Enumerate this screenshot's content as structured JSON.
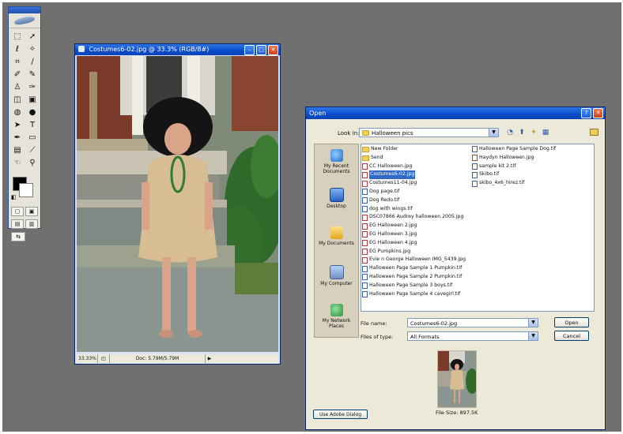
{
  "image_window": {
    "title": "Costumes6-02.jpg @ 33.3% (RGB/8#)",
    "status_zoom": "33.33%",
    "status_doc": "Doc: 5.79M/5.79M"
  },
  "dialog": {
    "title": "Open",
    "look_in_label": "Look in:",
    "look_in_value": "Halloween pics",
    "places": [
      {
        "label": "My Recent Documents",
        "icon": "recent-documents-icon"
      },
      {
        "label": "Desktop",
        "icon": "desktop-icon"
      },
      {
        "label": "My Documents",
        "icon": "my-documents-icon"
      },
      {
        "label": "My Computer",
        "icon": "my-computer-icon"
      },
      {
        "label": "My Network Places",
        "icon": "network-places-icon"
      }
    ],
    "files_col1": [
      {
        "name": "New Folder",
        "type": "folder"
      },
      {
        "name": "Send",
        "type": "folder"
      },
      {
        "name": "CC Halloween.jpg",
        "type": "jpg"
      },
      {
        "name": "Costumes6-02.jpg",
        "type": "jpg",
        "selected": true
      },
      {
        "name": "Costumes11-04.jpg",
        "type": "jpg"
      },
      {
        "name": "Dog page.tif",
        "type": "tif"
      },
      {
        "name": "Dog Redo.tif",
        "type": "tif"
      },
      {
        "name": "dog with wings.tif",
        "type": "tif"
      },
      {
        "name": "DSC07866 Audrey halloween 2005.jpg",
        "type": "jpg"
      },
      {
        "name": "EG Halloween 2.jpg",
        "type": "jpg"
      },
      {
        "name": "EG Halloween 3.jpg",
        "type": "jpg"
      },
      {
        "name": "EG Halloween 4.jpg",
        "type": "jpg"
      },
      {
        "name": "EG Pumpkins.jpg",
        "type": "jpg"
      },
      {
        "name": "Evie n George Halloween IMG_5439.jpg",
        "type": "jpg"
      },
      {
        "name": "Halloween Page Sample 1 Pumpkin.tif",
        "type": "tif"
      },
      {
        "name": "Halloween Page Sample 2 Pumpkin.tif",
        "type": "tif"
      },
      {
        "name": "Halloween Page Sample 3 boys.tif",
        "type": "tif"
      },
      {
        "name": "Halloween Page Sample 4 cavegirl.tif",
        "type": "tif"
      }
    ],
    "files_col2": [
      {
        "name": "Halloween Page Sample Dog.tif",
        "type": "tif"
      },
      {
        "name": "Haydyn Halloween.jpg",
        "type": "jpg"
      },
      {
        "name": "sample kit 2.tif",
        "type": "tif"
      },
      {
        "name": "Skibo.tif",
        "type": "tif"
      },
      {
        "name": "skibo_4x6_hirez.tif",
        "type": "tif"
      }
    ],
    "file_name_label": "File name:",
    "file_name_value": "Costumes6-02.jpg",
    "file_type_label": "Files of type:",
    "file_type_value": "All Formats",
    "open_label": "Open",
    "cancel_label": "Cancel",
    "file_size": "File Size: 897.5K",
    "adobe_dialog_label": "Use Adobe Dialog"
  },
  "colors": {
    "workspace": "#707070",
    "xp_title": "#0a4bcc",
    "selection": "#316ac5"
  }
}
